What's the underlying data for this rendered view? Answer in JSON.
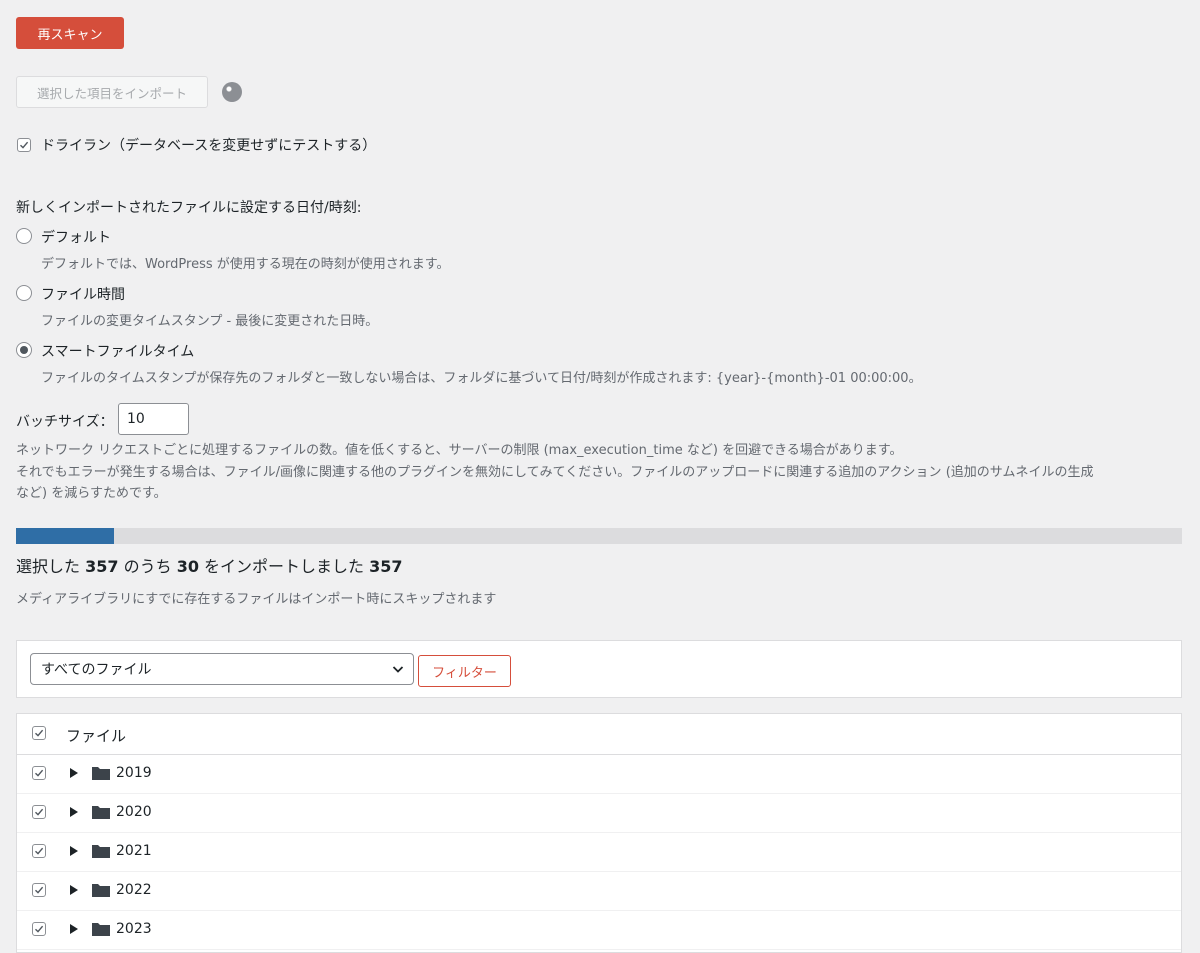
{
  "rescan_label": "再スキャン",
  "import_selected_label": "選択した項目をインポート",
  "dry_run": {
    "checked": true,
    "label": "ドライラン（データベースを変更せずにテストする）"
  },
  "date_section": {
    "title": "新しくインポートされたファイルに設定する日付/時刻:",
    "options": [
      {
        "label": "デフォルト",
        "desc": "デフォルトでは、WordPress が使用する現在の時刻が使用されます。",
        "selected": false
      },
      {
        "label": "ファイル時間",
        "desc": "ファイルの変更タイムスタンプ - 最後に変更された日時。",
        "selected": false
      },
      {
        "label": "スマートファイルタイム",
        "desc": "ファイルのタイムスタンプが保存先のフォルダと一致しない場合は、フォルダに基づいて日付/時刻が作成されます: {year}-{month}-01 00:00:00。",
        "selected": true
      }
    ]
  },
  "batch": {
    "label": "バッチサイズ：",
    "value": "10",
    "desc1": "ネットワーク リクエストごとに処理するファイルの数。値を低くすると、サーバーの制限 (max_execution_time など) を回避できる場合があります。",
    "desc2a": "それでもエラーが発生する場合は、ファイル/画像に関連する他のプラグインを無効にしてみてください。ファイルのアップロードに関連する追加のアクション (追加のサムネイルの生成",
    "desc2b": "など) を減らすためです。"
  },
  "progress": {
    "fraction": 0.084,
    "prefix": "選択した ",
    "total": "357",
    "middle": " のうち ",
    "done": "30",
    "suffix": " をインポートしました ",
    "total_again": "357",
    "skip_note": "メディアライブラリにすでに存在するファイルはインポート時にスキップされます"
  },
  "filter": {
    "selected": "すべてのファイル",
    "button": "フィルター"
  },
  "table": {
    "header": "ファイル",
    "rows": [
      {
        "name": "2019",
        "checked": true
      },
      {
        "name": "2020",
        "checked": true
      },
      {
        "name": "2021",
        "checked": true
      },
      {
        "name": "2022",
        "checked": true
      },
      {
        "name": "2023",
        "checked": true
      }
    ]
  },
  "colors": {
    "accent": "#d54e3b",
    "progress": "#2f6ea6",
    "background": "#f0f0f1"
  }
}
